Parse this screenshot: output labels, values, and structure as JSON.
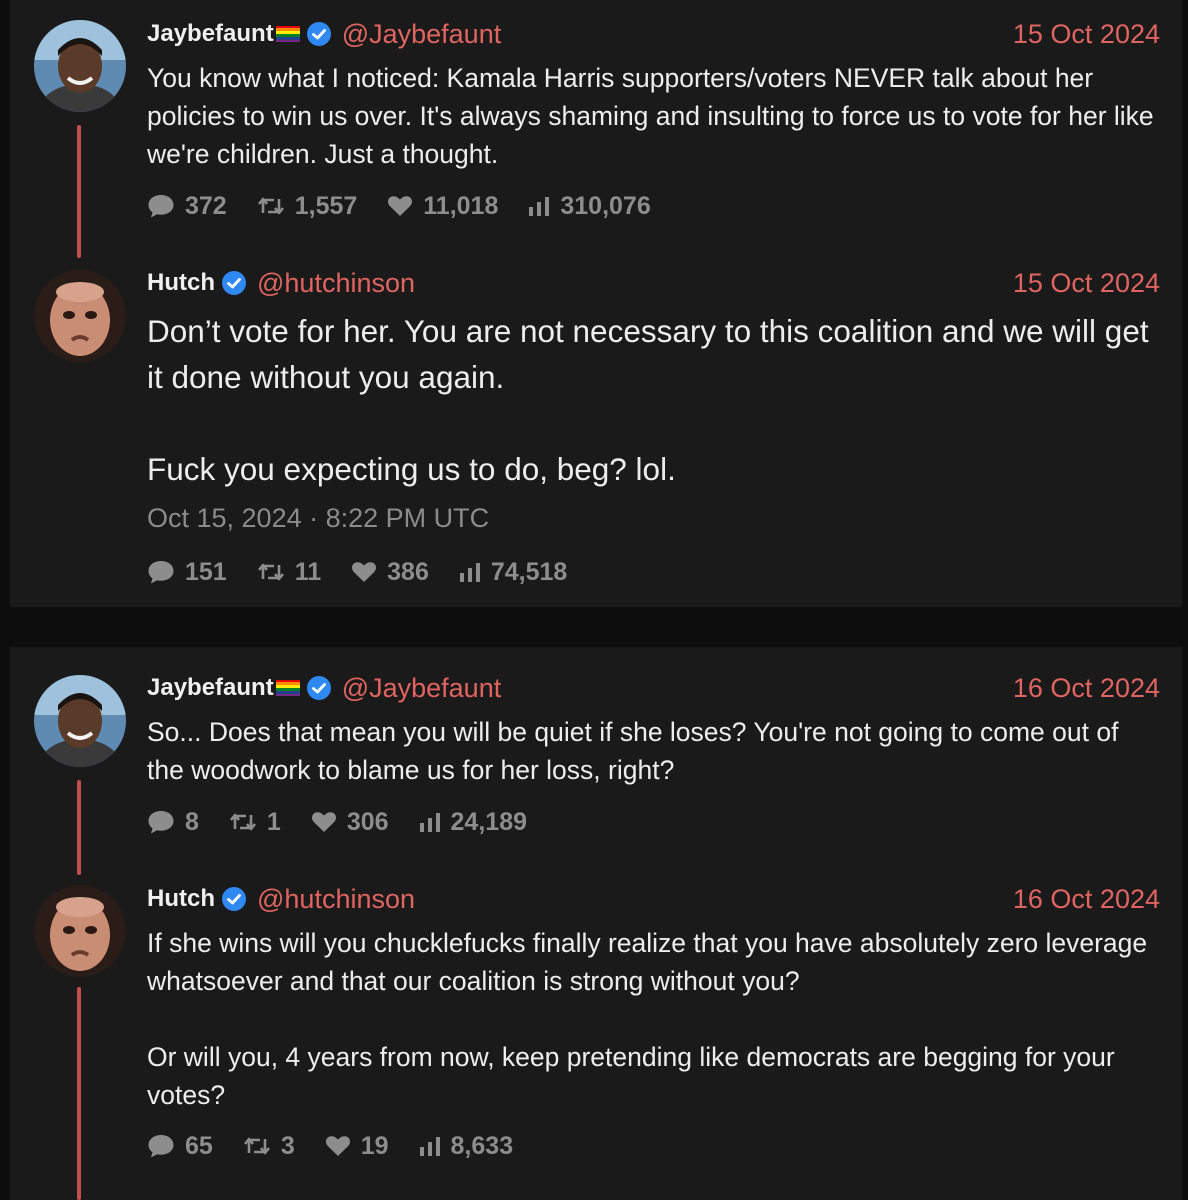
{
  "colors": {
    "accent": "#e0645f",
    "thread": "#c0504d",
    "verified": "#2e8af2",
    "stat": "#8d8d8d"
  },
  "icons": {
    "reply": "comment-icon",
    "retweet": "retweet-icon",
    "like": "heart-icon",
    "views": "views-icon",
    "verified": "verified-badge-icon",
    "flag": "rainbow-flag-icon"
  },
  "thread1": {
    "tweet1": {
      "name": "Jaybefaunt",
      "handle": "@Jaybefaunt",
      "date": "15 Oct 2024",
      "text": "You know what I noticed: Kamala Harris supporters/voters NEVER talk about her policies to win us over. It's always shaming and insulting to force us to vote for her like we're children. Just a thought.",
      "replies": "372",
      "retweets": "1,557",
      "likes": "11,018",
      "views": "310,076"
    },
    "tweet2": {
      "name": "Hutch",
      "handle": "@hutchinson",
      "date": "15 Oct 2024",
      "text": "Don’t vote for her. You are not necessary to this coalition and we will get it done without you again.\n\nFuck you expecting us to do, beg? lol.",
      "timestamp": "Oct 15, 2024 · 8:22 PM UTC",
      "replies": "151",
      "retweets": "11",
      "likes": "386",
      "views": "74,518"
    }
  },
  "thread2": {
    "tweet1": {
      "name": "Jaybefaunt",
      "handle": "@Jaybefaunt",
      "date": "16 Oct 2024",
      "text": "So... Does that mean you will be quiet if she loses? You're not going to come out of the woodwork to blame us for her loss, right?",
      "replies": "8",
      "retweets": "1",
      "likes": "306",
      "views": "24,189"
    },
    "tweet2": {
      "name": "Hutch",
      "handle": "@hutchinson",
      "date": "16 Oct 2024",
      "text": "If she wins will you chucklefucks finally realize that you have absolutely zero leverage whatsoever and that our coalition is strong without you?\n\nOr will you, 4 years from now, keep pretending like democrats are begging for your votes?",
      "replies": "65",
      "retweets": "3",
      "likes": "19",
      "views": "8,633"
    }
  }
}
